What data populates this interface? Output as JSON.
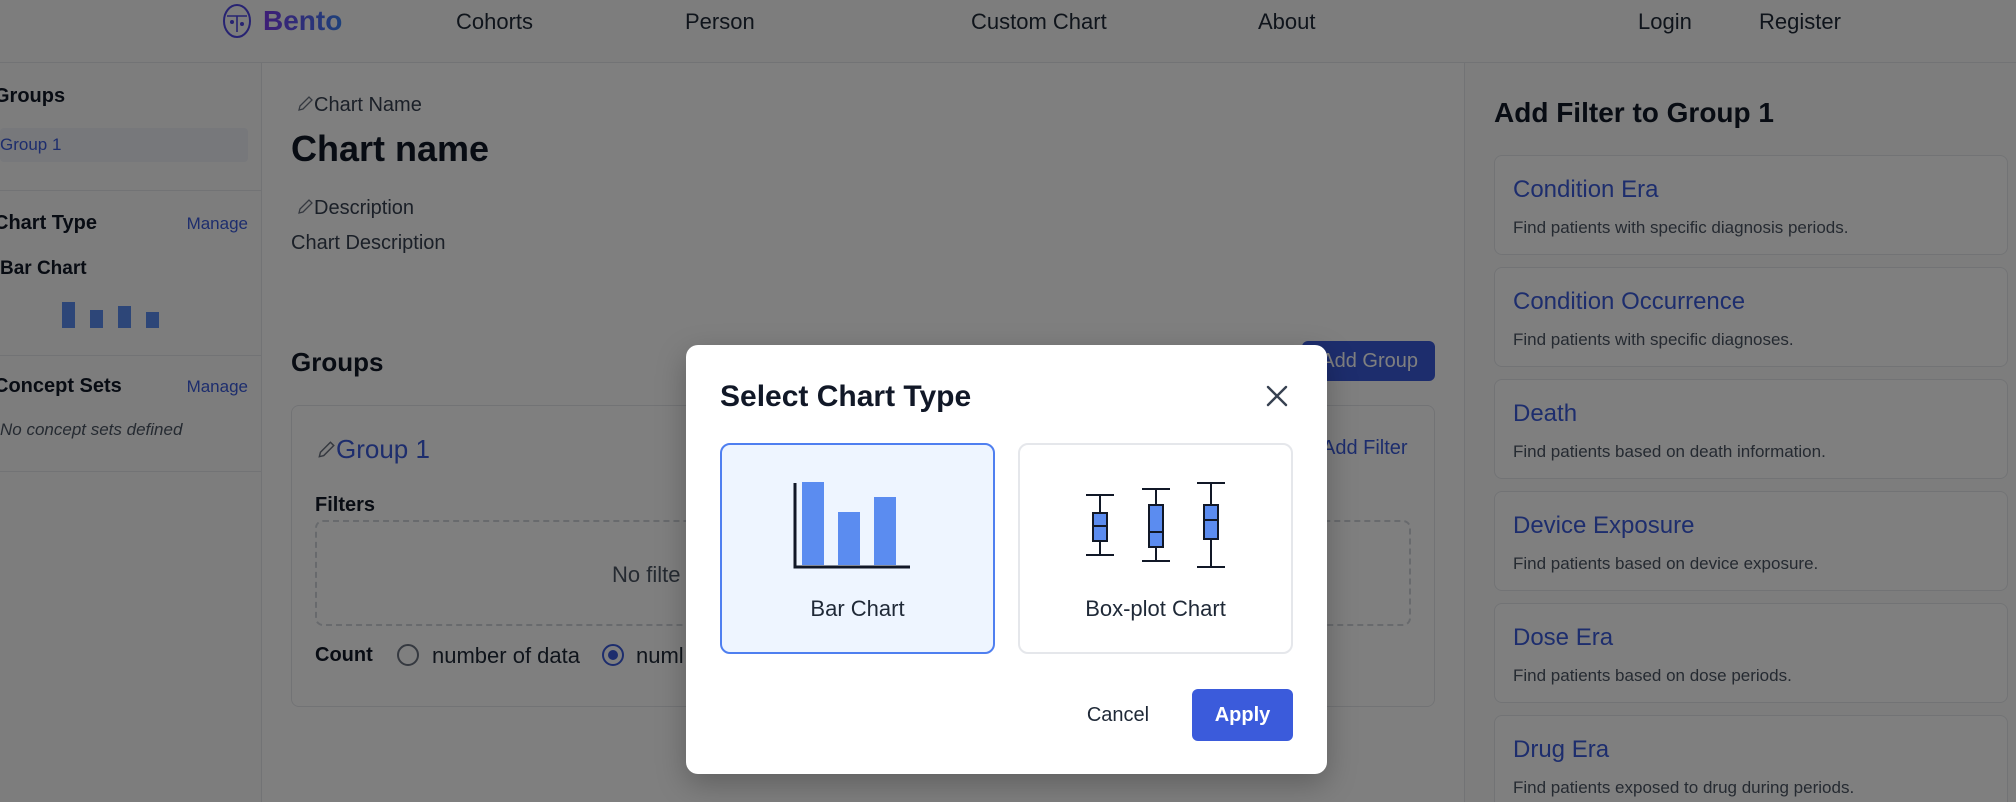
{
  "nav": {
    "brand": "Bento",
    "links": [
      "Cohorts",
      "Person",
      "Custom Chart",
      "About"
    ],
    "login": "Login",
    "register": "Register"
  },
  "sidebar": {
    "groups_title": "Groups",
    "group_item": "Group 1",
    "chart_type_title": "Chart Type",
    "chart_type_manage": "Manage",
    "chart_type_value": "Bar Chart",
    "concept_sets_title": "Concept Sets",
    "concept_sets_manage": "Manage",
    "concept_sets_empty": "No concept sets defined"
  },
  "main": {
    "chart_name_label": "Chart Name",
    "chart_name": "Chart name",
    "description_label": "Description",
    "description": "Chart Description",
    "groups_title": "Groups",
    "add_group": "Add Group",
    "group_name": "Group 1",
    "add_filter": "Add Filter",
    "filters_label": "Filters",
    "no_filters": "No filte",
    "count_label": "Count",
    "count_option_1": "number of data",
    "count_option_2": "numl"
  },
  "right_panel": {
    "title": "Add Filter to Group 1",
    "filters": [
      {
        "title": "Condition Era",
        "desc": "Find patients with specific diagnosis periods."
      },
      {
        "title": "Condition Occurrence",
        "desc": "Find patients with specific diagnoses."
      },
      {
        "title": "Death",
        "desc": "Find patients based on death information."
      },
      {
        "title": "Device Exposure",
        "desc": "Find patients based on device exposure."
      },
      {
        "title": "Dose Era",
        "desc": "Find patients based on dose periods."
      },
      {
        "title": "Drug Era",
        "desc": "Find patients exposed to drug during periods."
      }
    ]
  },
  "modal": {
    "title": "Select Chart Type",
    "options": [
      "Bar Chart",
      "Box-plot Chart"
    ],
    "selected": "Bar Chart",
    "cancel": "Cancel",
    "apply": "Apply"
  },
  "colors": {
    "accent": "#3b5bdb",
    "selected_border": "#4f7ff0",
    "selected_bg": "#eef5ff",
    "bar_fill": "#5b8cf0"
  }
}
